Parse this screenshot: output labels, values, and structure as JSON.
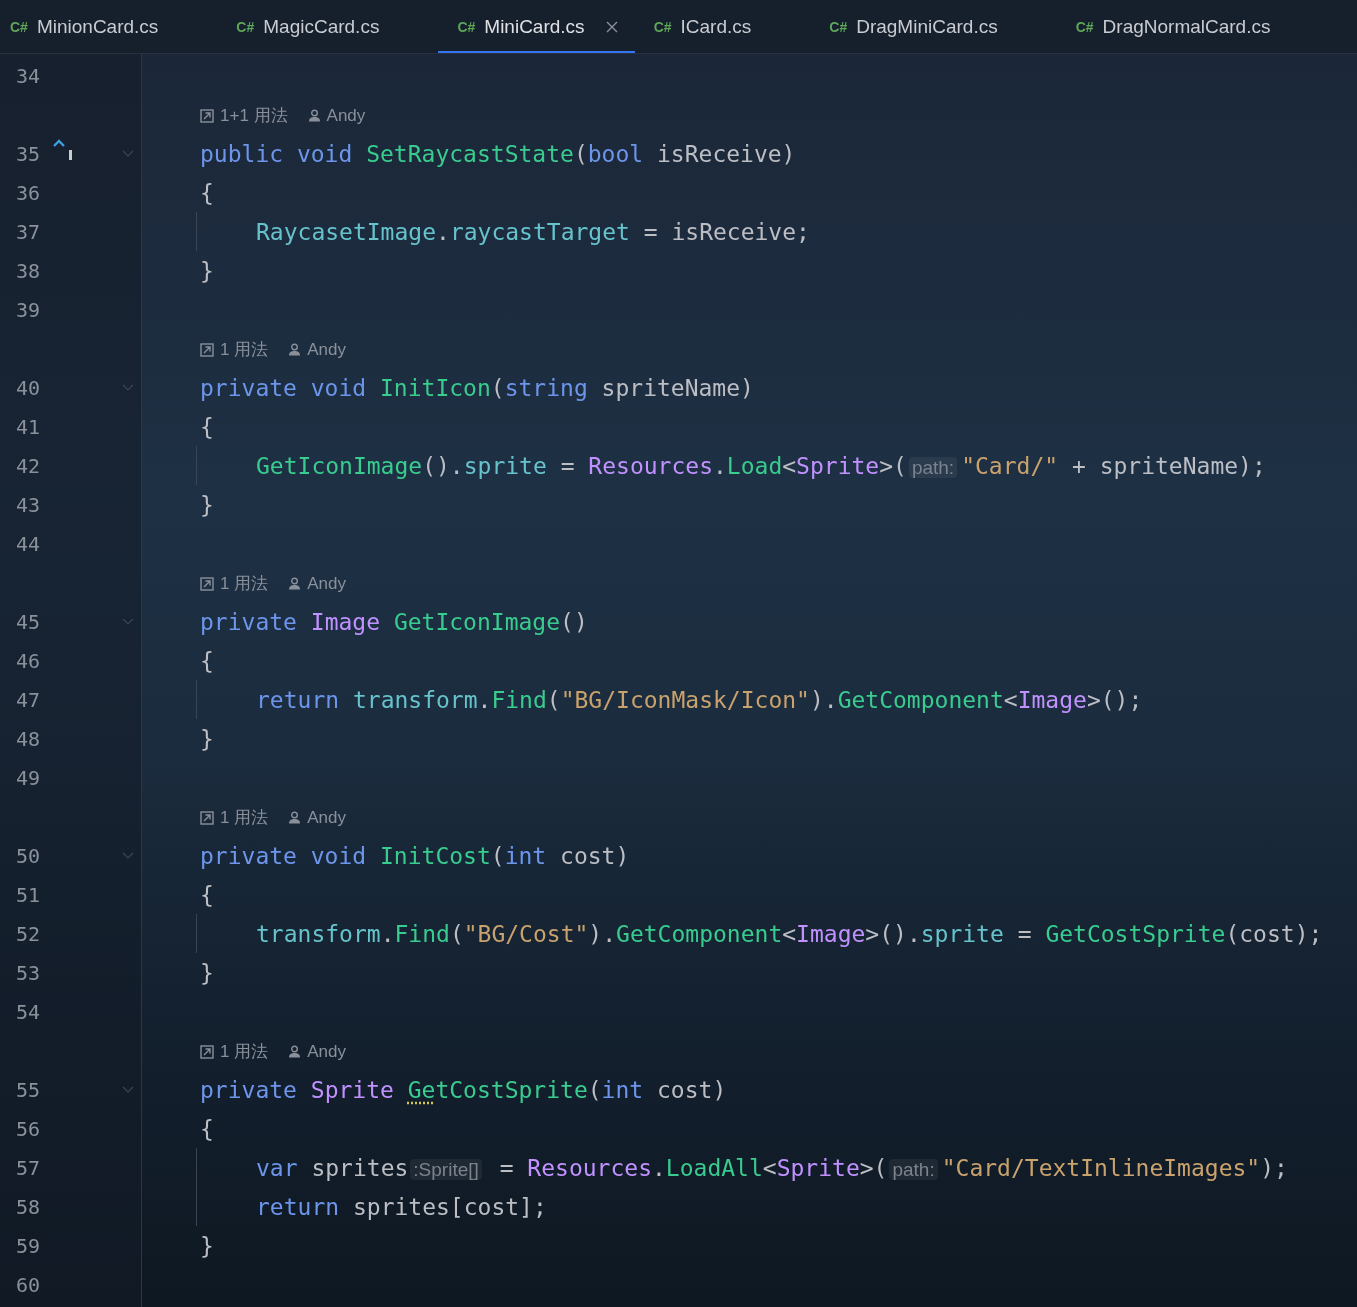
{
  "tabs": [
    {
      "badge": "C#",
      "label": "MinionCard.cs",
      "selected": false
    },
    {
      "badge": "C#",
      "label": "MagicCard.cs",
      "selected": false
    },
    {
      "badge": "C#",
      "label": "MiniCard.cs",
      "selected": true
    },
    {
      "badge": "C#",
      "label": "ICard.cs",
      "selected": false
    },
    {
      "badge": "C#",
      "label": "DragMiniCard.cs",
      "selected": false
    },
    {
      "badge": "C#",
      "label": "DragNormalCard.cs",
      "selected": false
    }
  ],
  "rows": [
    {
      "kind": "code",
      "number": "34",
      "foldable": false,
      "implements": false,
      "tokens": []
    },
    {
      "kind": "lens",
      "usages": "1+1 用法",
      "author": "Andy"
    },
    {
      "kind": "code",
      "number": "35",
      "indented": false,
      "foldable": true,
      "implements": true,
      "tokens": [
        {
          "text": "public void ",
          "kind": "keyword"
        },
        {
          "text": "SetRaycastState",
          "kind": "method"
        },
        {
          "text": "(",
          "kind": "plain"
        },
        {
          "text": "bool",
          "kind": "keyword"
        },
        {
          "text": " isReceive)",
          "kind": "plain"
        }
      ]
    },
    {
      "kind": "code",
      "number": "36",
      "indented": false,
      "foldable": false,
      "implements": false,
      "tokens": [
        {
          "text": "{",
          "kind": "plain"
        }
      ]
    },
    {
      "kind": "code",
      "number": "37",
      "indented": true,
      "foldable": false,
      "implements": false,
      "tokens": [
        {
          "text": "RaycasetImage",
          "kind": "field"
        },
        {
          "text": ".",
          "kind": "plain"
        },
        {
          "text": "raycastTarget",
          "kind": "field"
        },
        {
          "text": " = isReceive;",
          "kind": "plain"
        }
      ]
    },
    {
      "kind": "code",
      "number": "38",
      "indented": false,
      "foldable": false,
      "implements": false,
      "tokens": [
        {
          "text": "}",
          "kind": "plain"
        }
      ]
    },
    {
      "kind": "code",
      "number": "39",
      "foldable": false,
      "implements": false,
      "tokens": []
    },
    {
      "kind": "lens",
      "usages": "1 用法",
      "author": "Andy"
    },
    {
      "kind": "code",
      "number": "40",
      "indented": false,
      "foldable": true,
      "implements": false,
      "tokens": [
        {
          "text": "private void ",
          "kind": "keyword"
        },
        {
          "text": "InitIcon",
          "kind": "method"
        },
        {
          "text": "(",
          "kind": "plain"
        },
        {
          "text": "string",
          "kind": "keyword"
        },
        {
          "text": " spriteName)",
          "kind": "plain"
        }
      ]
    },
    {
      "kind": "code",
      "number": "41",
      "indented": false,
      "foldable": false,
      "implements": false,
      "tokens": [
        {
          "text": "{",
          "kind": "plain"
        }
      ]
    },
    {
      "kind": "code",
      "number": "42",
      "indented": true,
      "foldable": false,
      "implements": false,
      "tokens": [
        {
          "text": "GetIconImage",
          "kind": "method"
        },
        {
          "text": "().",
          "kind": "plain"
        },
        {
          "text": "sprite",
          "kind": "field"
        },
        {
          "text": " = ",
          "kind": "plain"
        },
        {
          "text": "Resources",
          "kind": "type"
        },
        {
          "text": ".",
          "kind": "plain"
        },
        {
          "text": "Load",
          "kind": "method"
        },
        {
          "text": "<",
          "kind": "plain"
        },
        {
          "text": "Sprite",
          "kind": "type"
        },
        {
          "text": ">(",
          "kind": "plain"
        },
        {
          "text": "path:",
          "kind": "inlay"
        },
        {
          "text": "\"Card/\"",
          "kind": "string"
        },
        {
          "text": " + spriteName);",
          "kind": "plain"
        }
      ]
    },
    {
      "kind": "code",
      "number": "43",
      "indented": false,
      "foldable": false,
      "implements": false,
      "tokens": [
        {
          "text": "}",
          "kind": "plain"
        }
      ]
    },
    {
      "kind": "code",
      "number": "44",
      "foldable": false,
      "implements": false,
      "tokens": []
    },
    {
      "kind": "lens",
      "usages": "1 用法",
      "author": "Andy"
    },
    {
      "kind": "code",
      "number": "45",
      "indented": false,
      "foldable": true,
      "implements": false,
      "tokens": [
        {
          "text": "private ",
          "kind": "keyword"
        },
        {
          "text": "Image ",
          "kind": "type"
        },
        {
          "text": "GetIconImage",
          "kind": "method"
        },
        {
          "text": "()",
          "kind": "plain"
        }
      ]
    },
    {
      "kind": "code",
      "number": "46",
      "indented": false,
      "foldable": false,
      "implements": false,
      "tokens": [
        {
          "text": "{",
          "kind": "plain"
        }
      ]
    },
    {
      "kind": "code",
      "number": "47",
      "indented": true,
      "foldable": false,
      "implements": false,
      "tokens": [
        {
          "text": "return ",
          "kind": "keyword"
        },
        {
          "text": "transform",
          "kind": "field"
        },
        {
          "text": ".",
          "kind": "plain"
        },
        {
          "text": "Find",
          "kind": "method"
        },
        {
          "text": "(",
          "kind": "plain"
        },
        {
          "text": "\"BG/IconMask/Icon\"",
          "kind": "string"
        },
        {
          "text": ").",
          "kind": "plain"
        },
        {
          "text": "GetComponent",
          "kind": "method"
        },
        {
          "text": "<",
          "kind": "plain"
        },
        {
          "text": "Image",
          "kind": "type"
        },
        {
          "text": ">();",
          "kind": "plain"
        }
      ]
    },
    {
      "kind": "code",
      "number": "48",
      "indented": false,
      "foldable": false,
      "implements": false,
      "tokens": [
        {
          "text": "}",
          "kind": "plain"
        }
      ]
    },
    {
      "kind": "code",
      "number": "49",
      "foldable": false,
      "implements": false,
      "tokens": []
    },
    {
      "kind": "lens",
      "usages": "1 用法",
      "author": "Andy"
    },
    {
      "kind": "code",
      "number": "50",
      "indented": false,
      "foldable": true,
      "implements": false,
      "tokens": [
        {
          "text": "private void ",
          "kind": "keyword"
        },
        {
          "text": "InitCost",
          "kind": "method"
        },
        {
          "text": "(",
          "kind": "plain"
        },
        {
          "text": "int",
          "kind": "keyword"
        },
        {
          "text": " cost)",
          "kind": "plain"
        }
      ]
    },
    {
      "kind": "code",
      "number": "51",
      "indented": false,
      "foldable": false,
      "implements": false,
      "tokens": [
        {
          "text": "{",
          "kind": "plain"
        }
      ]
    },
    {
      "kind": "code",
      "number": "52",
      "indented": true,
      "foldable": false,
      "implements": false,
      "tokens": [
        {
          "text": "transform",
          "kind": "field"
        },
        {
          "text": ".",
          "kind": "plain"
        },
        {
          "text": "Find",
          "kind": "method"
        },
        {
          "text": "(",
          "kind": "plain"
        },
        {
          "text": "\"BG/Cost\"",
          "kind": "string"
        },
        {
          "text": ").",
          "kind": "plain"
        },
        {
          "text": "GetComponent",
          "kind": "method"
        },
        {
          "text": "<",
          "kind": "plain"
        },
        {
          "text": "Image",
          "kind": "type"
        },
        {
          "text": ">().",
          "kind": "plain"
        },
        {
          "text": "sprite",
          "kind": "field"
        },
        {
          "text": " = ",
          "kind": "plain"
        },
        {
          "text": "GetCostSprite",
          "kind": "method"
        },
        {
          "text": "(cost);",
          "kind": "plain"
        }
      ]
    },
    {
      "kind": "code",
      "number": "53",
      "indented": false,
      "foldable": false,
      "implements": false,
      "tokens": [
        {
          "text": "}",
          "kind": "plain"
        }
      ]
    },
    {
      "kind": "code",
      "number": "54",
      "foldable": false,
      "implements": false,
      "tokens": []
    },
    {
      "kind": "lens",
      "usages": "1 用法",
      "author": "Andy"
    },
    {
      "kind": "code",
      "number": "55",
      "indented": false,
      "foldable": true,
      "implements": false,
      "tokens": [
        {
          "text": "private ",
          "kind": "keyword"
        },
        {
          "text": "Sprite ",
          "kind": "type"
        },
        {
          "text": "Ge",
          "kind": "method-warning"
        },
        {
          "text": "tCostSprite",
          "kind": "method"
        },
        {
          "text": "(",
          "kind": "plain"
        },
        {
          "text": "int",
          "kind": "keyword"
        },
        {
          "text": " cost)",
          "kind": "plain"
        }
      ]
    },
    {
      "kind": "code",
      "number": "56",
      "indented": false,
      "foldable": false,
      "implements": false,
      "tokens": [
        {
          "text": "{",
          "kind": "plain"
        }
      ]
    },
    {
      "kind": "code",
      "number": "57",
      "indented": true,
      "foldable": false,
      "implements": false,
      "tokens": [
        {
          "text": "var ",
          "kind": "keyword"
        },
        {
          "text": "sprites",
          "kind": "plain"
        },
        {
          "text": ":Sprite[]",
          "kind": "inlay"
        },
        {
          "text": " = ",
          "kind": "plain"
        },
        {
          "text": "Resources",
          "kind": "type"
        },
        {
          "text": ".",
          "kind": "plain"
        },
        {
          "text": "LoadAll",
          "kind": "method"
        },
        {
          "text": "<",
          "kind": "plain"
        },
        {
          "text": "Sprite",
          "kind": "type"
        },
        {
          "text": ">(",
          "kind": "plain"
        },
        {
          "text": "path:",
          "kind": "inlay"
        },
        {
          "text": "\"Card/TextInlineImages\"",
          "kind": "string"
        },
        {
          "text": ");",
          "kind": "plain"
        }
      ]
    },
    {
      "kind": "code",
      "number": "58",
      "indented": true,
      "foldable": false,
      "implements": false,
      "tokens": [
        {
          "text": "return ",
          "kind": "keyword"
        },
        {
          "text": "sprites[cost];",
          "kind": "plain"
        }
      ]
    },
    {
      "kind": "code",
      "number": "59",
      "indented": false,
      "foldable": false,
      "implements": false,
      "tokens": [
        {
          "text": "}",
          "kind": "plain"
        }
      ]
    },
    {
      "kind": "code",
      "number": "60",
      "foldable": false,
      "implements": false,
      "tokens": []
    }
  ]
}
